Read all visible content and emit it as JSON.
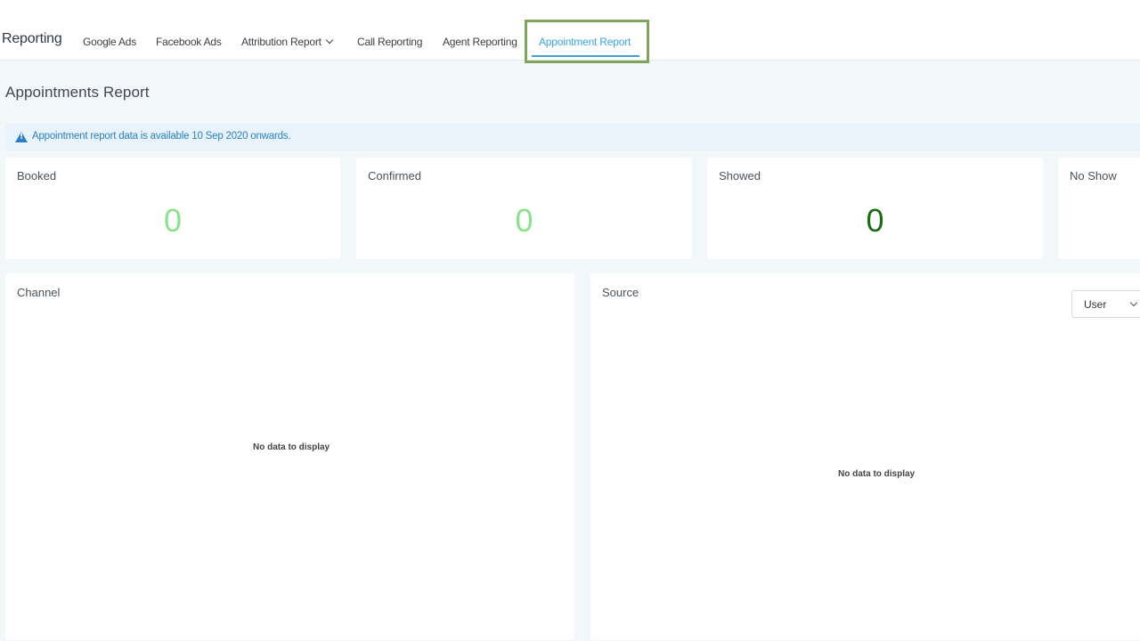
{
  "header": {
    "brand": "Reporting",
    "tabs": [
      {
        "label": "Google Ads"
      },
      {
        "label": "Facebook Ads"
      },
      {
        "label": "Attribution Report"
      },
      {
        "label": "Call Reporting"
      },
      {
        "label": "Agent Reporting"
      },
      {
        "label": "Appointment Report"
      }
    ],
    "active_tab": "Appointment Report"
  },
  "page": {
    "title": "Appointments Report",
    "alert": {
      "icon": "warning-triangle-icon",
      "text": "Appointment report data is available 10 Sep 2020 onwards."
    }
  },
  "stats": [
    {
      "label": "Booked",
      "value": "0",
      "color": "#8ee08a"
    },
    {
      "label": "Confirmed",
      "value": "0",
      "color": "#8ee08a"
    },
    {
      "label": "Showed",
      "value": "0",
      "color": "#1f6b1a"
    },
    {
      "label": "No Show",
      "value": "",
      "color": "#1f6b1a"
    }
  ],
  "panels": {
    "channel": {
      "title": "Channel",
      "empty": "No data to display"
    },
    "source": {
      "title": "Source",
      "empty": "No data to display",
      "select_value": "User"
    }
  },
  "colors": {
    "accent": "#3aa4d9",
    "highlight_border": "#7ea55b",
    "alert_text": "#2b7fc1"
  }
}
